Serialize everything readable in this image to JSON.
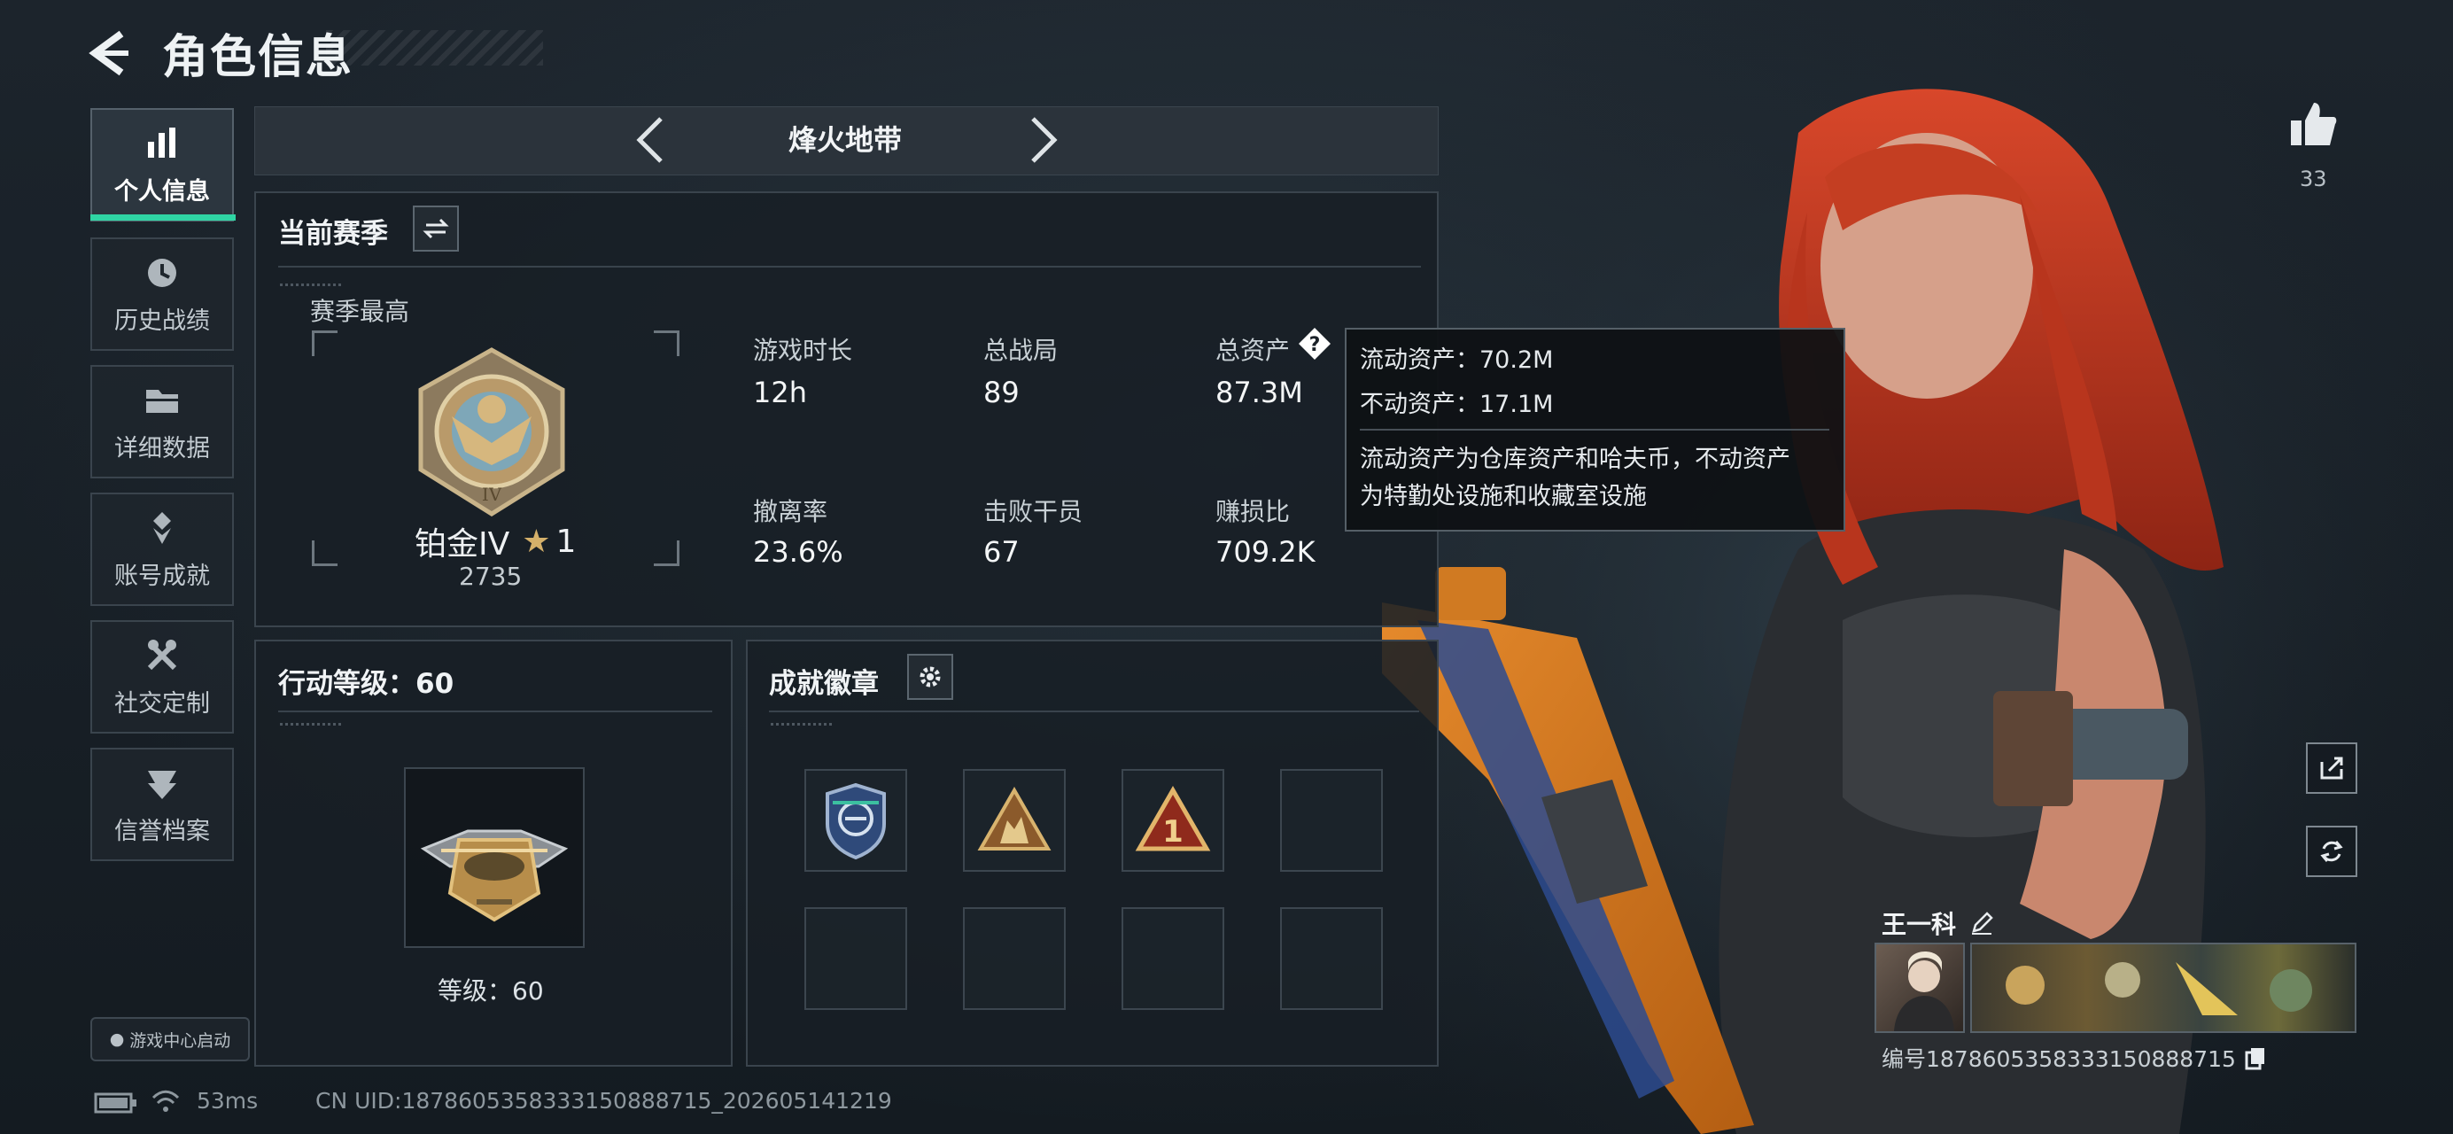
{
  "header": {
    "title": "角色信息"
  },
  "sidebar": {
    "items": [
      {
        "label": "个人信息",
        "icon": "bar-chart-icon",
        "active": true
      },
      {
        "label": "历史战绩",
        "icon": "history-clock-icon",
        "active": false
      },
      {
        "label": "详细数据",
        "icon": "folder-icon",
        "active": false
      },
      {
        "label": "账号成就",
        "icon": "achievement-medal-icon",
        "active": false
      },
      {
        "label": "社交定制",
        "icon": "tools-icon",
        "active": false
      },
      {
        "label": "信誉档案",
        "icon": "shield-rank-icon",
        "active": false
      }
    ],
    "launch_label": "游戏中心启动"
  },
  "mode": {
    "title": "烽火地带"
  },
  "season": {
    "title": "当前赛季",
    "best_label": "赛季最高",
    "rank_name": "铂金IV",
    "rank_stars": "1",
    "rank_score": "2735",
    "stats": [
      {
        "label": "游戏时长",
        "value": "12h"
      },
      {
        "label": "总战局",
        "value": "89"
      },
      {
        "label": "总资产",
        "value": "87.3M"
      },
      {
        "label": "撤离率",
        "value": "23.6%"
      },
      {
        "label": "击败干员",
        "value": "67"
      },
      {
        "label": "赚损比",
        "value": "709.2K"
      }
    ]
  },
  "tooltip": {
    "line1": "流动资产：70.2M",
    "line2": "不动资产：17.1M",
    "desc1": "流动资产为仓库资产和哈夫币，不动资产",
    "desc2": "为特勤处设施和收藏室设施"
  },
  "level": {
    "title": "行动等级：60",
    "caption": "等级：60"
  },
  "badges": {
    "title": "成就徽章",
    "filled": 3,
    "total_slots": 8
  },
  "likes": {
    "count": "33"
  },
  "player": {
    "name": "王一科",
    "id_text": "编号1878605358333150888715"
  },
  "footer": {
    "ping": "53ms",
    "uid": "CN UID:1878605358333150888715_202605141219"
  },
  "colors": {
    "accent": "#2fd5a4",
    "hair": "#c8361f",
    "gold": "#c89a52"
  }
}
